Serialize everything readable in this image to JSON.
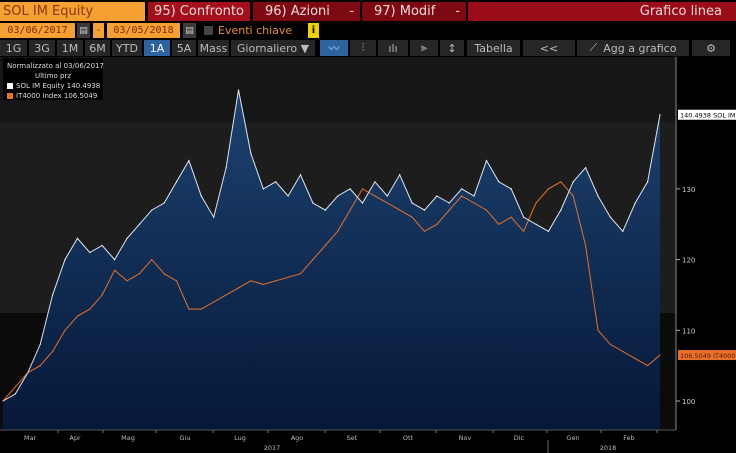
{
  "header": {
    "security": "SOL IM Equity",
    "tab_compare": "95) Confronto",
    "tab_actions": "96) Azioni",
    "tab_modify": "97) Modif",
    "dropdown_symbol": "-",
    "chart_type": "Grafico linea"
  },
  "dates": {
    "start": "03/06/2017",
    "separator": "-",
    "end": "03/05/2018",
    "events_label": "Eventi chiave",
    "info_symbol": "i"
  },
  "toolbar": {
    "periods": [
      "1G",
      "3G",
      "1M",
      "6M",
      "YTD",
      "1A",
      "5A",
      "Mass"
    ],
    "selected_period": "1A",
    "frequency": "Giornaliero ▼",
    "table": "Tabella",
    "collapse": "<<",
    "add_to_chart": "Agg a grafico"
  },
  "legend": {
    "title": "Normalizzato al 03/06/2017",
    "subtitle": "Ultimo prz",
    "series": [
      {
        "name": "SOL IM Equity",
        "value": "140.4938"
      },
      {
        "name": "IT4000 Index",
        "value": "106.5049"
      }
    ]
  },
  "colors": {
    "sol": "#ffffff",
    "it4000": "#e8702a",
    "accent": "#f5a033"
  },
  "chart_data": {
    "type": "line",
    "title": "",
    "xlabel": "",
    "ylabel": "",
    "ylim": [
      95,
      146
    ],
    "x_range": [
      "2017-03-06",
      "2018-03-05"
    ],
    "yticks": [
      100,
      110,
      120,
      130
    ],
    "xticks": [
      "Mar",
      "Apr",
      "Mag",
      "Giu",
      "Lug",
      "Ago",
      "Set",
      "Ott",
      "Nov",
      "Dic",
      "Gen",
      "Feb"
    ],
    "years": [
      "2017",
      "2018"
    ],
    "series": [
      {
        "name": "SOL IM Equity",
        "last_label": "140.4938 SOL IM",
        "values": [
          100,
          101,
          104,
          108,
          115,
          120,
          123,
          121,
          122,
          120,
          123,
          125,
          127,
          128,
          131,
          134,
          129,
          126,
          133,
          144,
          135,
          130,
          131,
          129,
          132,
          128,
          127,
          129,
          130,
          128,
          131,
          129,
          132,
          128,
          127,
          129,
          128,
          130,
          129,
          134,
          131,
          130,
          126,
          125,
          124,
          127,
          131,
          133,
          129,
          126,
          124,
          128,
          131,
          140.49
        ]
      },
      {
        "name": "IT4000 Index",
        "last_label": "106.5049 IT4000",
        "values": [
          100,
          102,
          104,
          105,
          107,
          110,
          112,
          113,
          115,
          118.5,
          117,
          118,
          120,
          118,
          117,
          113,
          113,
          114,
          115,
          116,
          117,
          116.5,
          117,
          117.5,
          118,
          120,
          122,
          124,
          127,
          130,
          129,
          128,
          127,
          126,
          124,
          125,
          127,
          129,
          128,
          127,
          125,
          126,
          124,
          128,
          130,
          131,
          129,
          122,
          110,
          108,
          107,
          106,
          105,
          106.5
        ]
      }
    ]
  }
}
